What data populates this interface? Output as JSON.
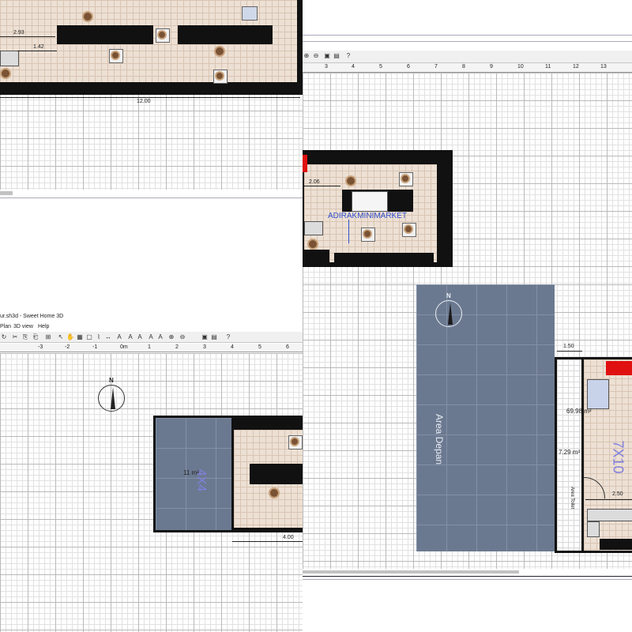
{
  "window": {
    "title": "ur.sh3d - Sweet Home 3D",
    "menu": [
      "Plan",
      "3D view",
      "Help"
    ]
  },
  "plan_top_left": {
    "dim_left": "2.93",
    "dim_inner": "1.42",
    "dim_total": "12.00"
  },
  "plan_top_right": {
    "ruler_ticks": [
      "3",
      "4",
      "5",
      "6",
      "7",
      "8",
      "9",
      "10",
      "11",
      "12",
      "13"
    ],
    "dim_left": "2.06",
    "store_name": "ADIRAKMINIMARKET"
  },
  "plan_bottom_left": {
    "ruler_ticks": [
      "-3",
      "-2",
      "-1",
      "0m",
      "1",
      "2",
      "3",
      "4",
      "5",
      "6"
    ],
    "compass_label": "N",
    "room_area": "11 m²",
    "room_name": "4X4",
    "dim_bottom": "4.00"
  },
  "plan_bottom_right": {
    "compass_label": "N",
    "area_depan_label": "Area Depan",
    "dim_top": "1.50",
    "area_main": "69.98 m²",
    "area_small": "7.29 m²",
    "room_name": "7X10",
    "area_toilet_label": "Area Toilet",
    "dim_right": "2.50"
  },
  "colors": {
    "wall": "#111111",
    "floor": "#ede0d4",
    "blue_area": "#6b7990",
    "room_label": "#8080e0",
    "accent_red": "#e01010"
  }
}
